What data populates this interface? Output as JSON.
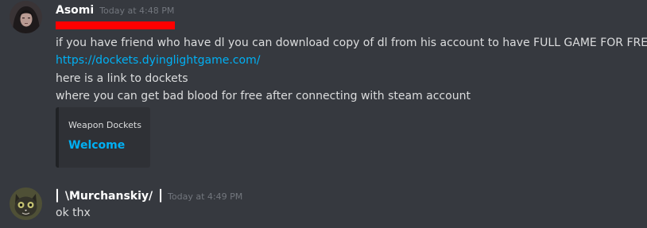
{
  "messages": [
    {
      "username": "Asomi",
      "timestamp": "Today at 4:48 PM",
      "lines": [
        "if you have friend who have dl you can download copy of dl from his account to have FULL GAME FOR FREE",
        "https://dockets.dyinglightgame.com/",
        "here is a link to dockets",
        "where you can get bad blood for free after connecting with steam account"
      ],
      "embed": {
        "provider": "Weapon Dockets",
        "title": "Welcome"
      }
    },
    {
      "username": "⎢ \\Murchanskiy/ ⎥",
      "timestamp": "Today at 4:49 PM",
      "lines": [
        "ok thx"
      ]
    }
  ],
  "colors": {
    "background": "#36393f",
    "link": "#00b0f4",
    "redaction": "#ff0000"
  },
  "icons": {
    "avatar1": "avatar-dark-haired-figure",
    "avatar2": "avatar-cat-face"
  }
}
